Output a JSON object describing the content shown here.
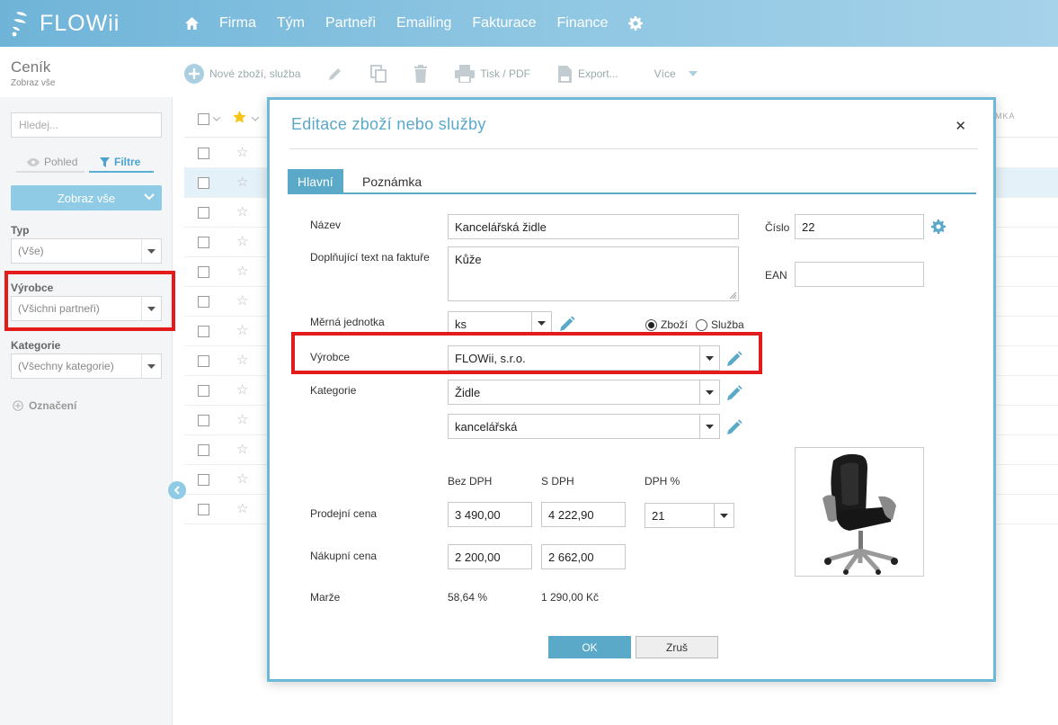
{
  "brand": {
    "name": "FLOWii"
  },
  "nav": {
    "items": [
      "Firma",
      "Tým",
      "Partneři",
      "Emailing",
      "Fakturace",
      "Finance"
    ]
  },
  "page": {
    "title": "Ceník",
    "subtitle": "Zobraz vše"
  },
  "toolbar": {
    "new_label": "Nové zboží, služba",
    "print_label": "Tisk / PDF",
    "export_label": "Export...",
    "more_label": "Více"
  },
  "sidebar": {
    "search_placeholder": "Hledej...",
    "view_tab": "Pohled",
    "filter_tab": "Filtre",
    "show_all": "Zobraz vše",
    "typ_label": "Typ",
    "typ_value": "(Vše)",
    "vyrobce_label": "Výrobce",
    "vyrobce_value": "(Všichni partneři)",
    "kategorie_label": "Kategorie",
    "kategorie_value": "(Všechny kategorie)",
    "oznaceni": "Označení"
  },
  "table": {
    "tail_header": "MKA"
  },
  "modal": {
    "title": "Editace zboží nebo služby",
    "tabs": [
      "Hlavní",
      "Poznámka"
    ],
    "labels": {
      "nazev": "Název",
      "doplnujici": "Doplňující text na faktuře",
      "cislo": "Číslo",
      "ean": "EAN",
      "merna": "Měrná jednotka",
      "vyrobce": "Výrobce",
      "kategorie": "Kategorie",
      "bez_dph": "Bez DPH",
      "s_dph": "S DPH",
      "dph_pct": "DPH %",
      "prodejni": "Prodejní cena",
      "nakupni": "Nákupní cena",
      "marze": "Marže"
    },
    "values": {
      "nazev": "Kancelářská židle",
      "doplnujici": "Kůže",
      "cislo": "22",
      "ean": "",
      "merna": "ks",
      "radio_goods": "Zboží",
      "radio_service": "Služba",
      "vyrobce": "FLOWii, s.r.o.",
      "kategorie": "Židle",
      "podkategorie": "kancelářská",
      "prodejni_bez": "3 490,00",
      "prodejni_s": "4 222,90",
      "dph": "21",
      "nakupni_bez": "2 200,00",
      "nakupni_s": "2 662,00",
      "marze_pct": "58,64 %",
      "marze_abs": "1 290,00 Kč"
    },
    "ok": "OK",
    "cancel": "Zruš"
  }
}
